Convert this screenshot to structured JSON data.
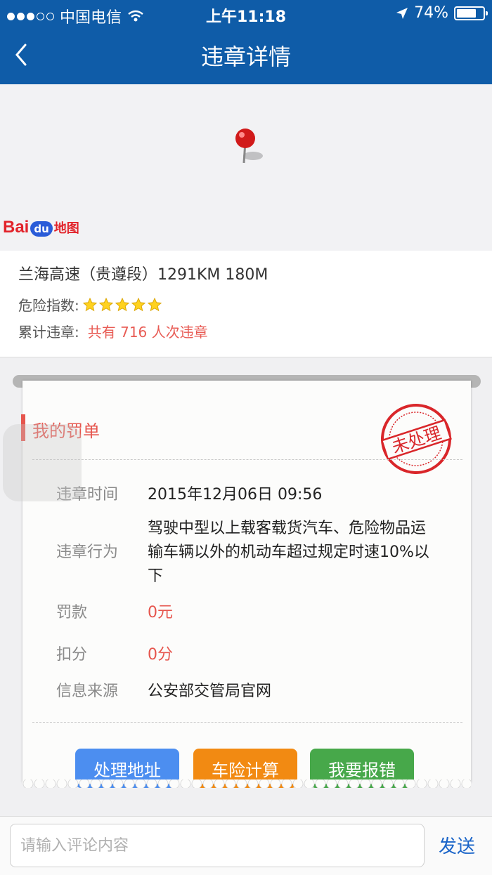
{
  "status_bar": {
    "carrier": "中国电信",
    "time": "上午11:18",
    "battery_text": "74%",
    "battery_level": 0.74
  },
  "nav": {
    "title": "违章详情"
  },
  "map": {
    "logo": {
      "bai": "Bai",
      "du": "du",
      "ditu": "地图"
    }
  },
  "location": {
    "road": "兰海高速（贵遵段）1291KM 180M",
    "danger_label": "危险指数:",
    "danger_rating": 5,
    "count_label": "累计违章:",
    "count_value": "共有 716 人次违章"
  },
  "ticket": {
    "heading": "我的罚单",
    "stamp_text": "未处理",
    "rows": [
      {
        "label": "违章时间",
        "value": "2015年12月06日 09:56"
      },
      {
        "label": "违章行为",
        "value_lines": [
          "驾驶中型以上载客载货汽车、危险物品运",
          "输车辆以外的机动车超过规定时速10%以",
          "下"
        ]
      },
      {
        "label": "罚款",
        "value": "0元"
      },
      {
        "label": "扣分",
        "value": "0分"
      },
      {
        "label": "信息来源",
        "value": "公安部交管局官网"
      }
    ],
    "buttons": {
      "address": "处理地址",
      "insurance": "车险计算",
      "report": "我要报错"
    }
  },
  "comment": {
    "placeholder": "请输入评论内容",
    "send_label": "发送"
  },
  "colors": {
    "nav_bg": "#0f5ca8",
    "accent_red": "#e6554d",
    "btn_blue": "#4c8ef0",
    "btn_orange": "#f28a12",
    "btn_green": "#47a84a",
    "send_blue": "#1a64c8"
  }
}
